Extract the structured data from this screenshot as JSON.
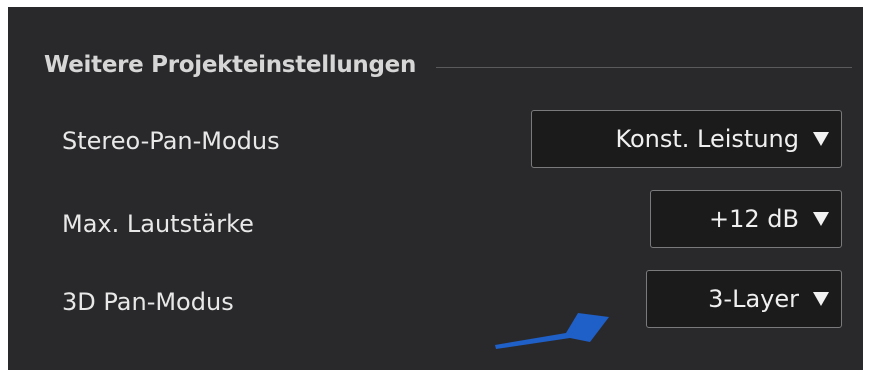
{
  "section": {
    "title": "Weitere Projekteinstellungen"
  },
  "rows": [
    {
      "label": "Stereo-Pan-Modus",
      "value": "Konst. Leistung"
    },
    {
      "label": "Max. Lautstärke",
      "value": "+12 dB"
    },
    {
      "label": "3D Pan-Modus",
      "value": "3-Layer"
    }
  ],
  "icons": {
    "dropdown": "triangle-down-icon",
    "annotation": "arrow-pointer-icon"
  },
  "colors": {
    "panel_background": "#29292b",
    "annotation_arrow": "#1f5fc8"
  }
}
